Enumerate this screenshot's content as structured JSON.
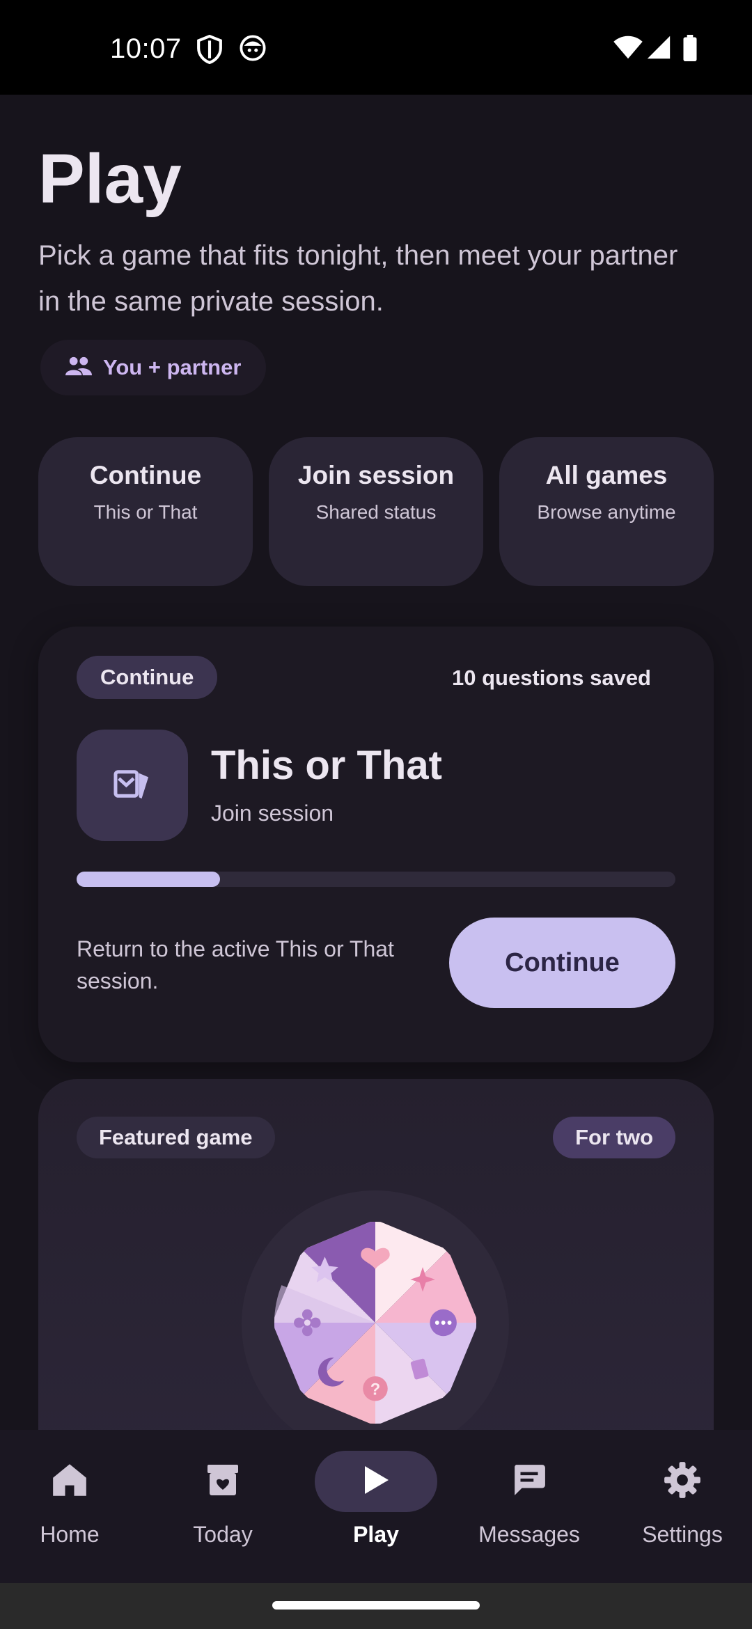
{
  "status_bar": {
    "time": "10:07",
    "icons": [
      "shield-icon",
      "face-icon",
      "wifi-icon",
      "signal-icon",
      "battery-icon"
    ]
  },
  "header": {
    "title": "Play",
    "subtitle": "Pick a game that fits tonight, then meet your partner in the same private session.",
    "partner_chip": "You + partner"
  },
  "quick_actions": [
    {
      "title": "Continue",
      "subtitle": "This or That"
    },
    {
      "title": "Join session",
      "subtitle": "Shared status"
    },
    {
      "title": "All games",
      "subtitle": "Browse anytime"
    }
  ],
  "continue_card": {
    "badge": "Continue",
    "saved": "10 questions saved",
    "game_title": "This or That",
    "game_subtitle": "Join session",
    "progress": 0.24,
    "description": "Return to the active This or That session.",
    "button": "Continue"
  },
  "featured_card": {
    "badge": "Featured game",
    "chip": "For two",
    "wheel_icons": [
      "heart-icon",
      "sparkle-icon",
      "chat-icon",
      "cards-icon",
      "question-icon",
      "moon-icon",
      "flower-icon",
      "star-icon"
    ]
  },
  "bottom_nav": {
    "items": [
      {
        "label": "Home",
        "icon": "home-icon"
      },
      {
        "label": "Today",
        "icon": "archive-heart-icon"
      },
      {
        "label": "Play",
        "icon": "play-icon",
        "active": true
      },
      {
        "label": "Messages",
        "icon": "message-icon"
      },
      {
        "label": "Settings",
        "icon": "gear-icon"
      }
    ]
  },
  "colors": {
    "background": "#17141c",
    "accent": "#c9c0f0",
    "chip_text": "#cdb6f0",
    "card": "#1d1923"
  }
}
